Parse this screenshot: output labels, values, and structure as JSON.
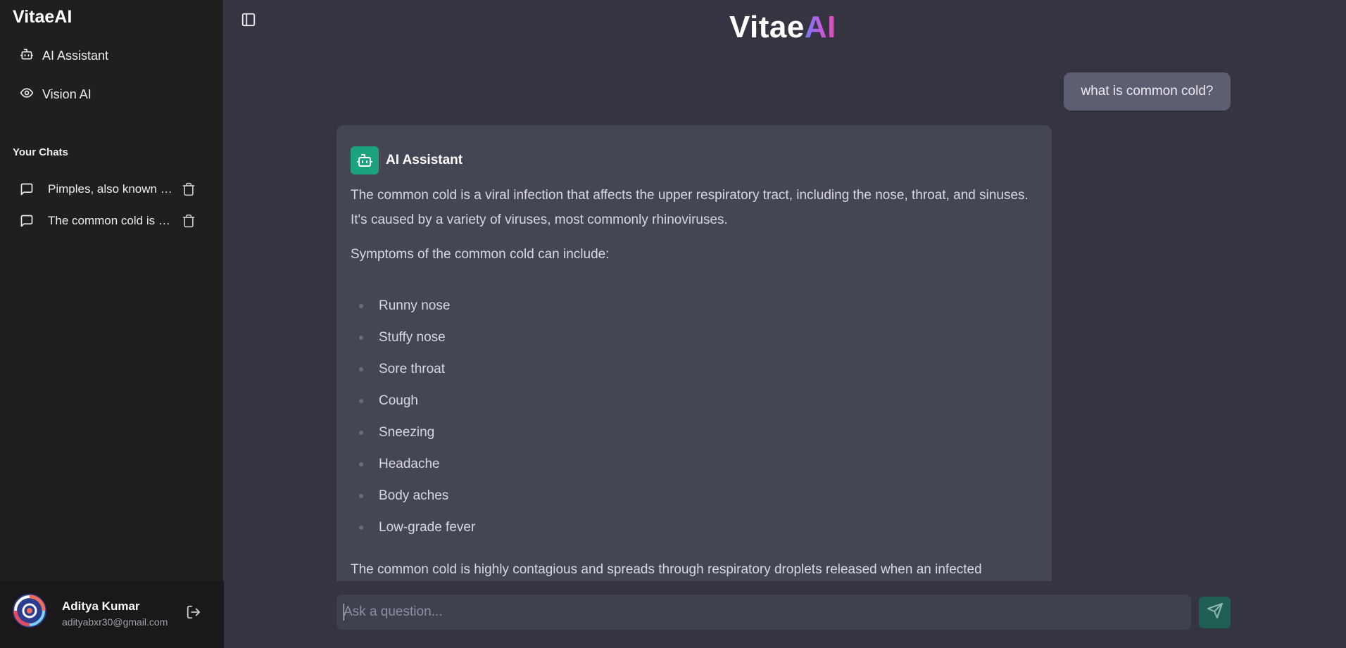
{
  "sidebar": {
    "brand": "VitaeAI",
    "nav": [
      {
        "label": "AI Assistant",
        "icon": "bot-icon"
      },
      {
        "label": "Vision AI",
        "icon": "eye-icon"
      }
    ],
    "section_title": "Your Chats",
    "chats": [
      {
        "title": "Pimples, also known as acne"
      },
      {
        "title": "The common cold is a viral infection"
      }
    ],
    "user": {
      "name": "Aditya Kumar",
      "email": "adityabxr30@gmail.com"
    }
  },
  "header": {
    "title_part1": "Vitae",
    "title_part2": "AI"
  },
  "conversation": {
    "user_message": "what is common cold?",
    "assistant_name": "AI Assistant",
    "paragraph1": "The common cold is a viral infection that affects the upper respiratory tract, including the nose, throat, and sinuses. It's caused by a variety of viruses, most commonly rhinoviruses.",
    "paragraph2": "Symptoms of the common cold can include:",
    "symptoms": [
      "Runny nose",
      "Stuffy nose",
      "Sore throat",
      "Cough",
      "Sneezing",
      "Headache",
      "Body aches",
      "Low-grade fever"
    ],
    "paragraph3": "The common cold is highly contagious and spreads through respiratory droplets released when an infected"
  },
  "composer": {
    "placeholder": "Ask a question..."
  },
  "colors": {
    "accent": "#1ba37e",
    "background": "#343541",
    "sidebar": "#211e1e",
    "assistant_bubble": "#444654",
    "user_bubble": "#5e5e73"
  }
}
